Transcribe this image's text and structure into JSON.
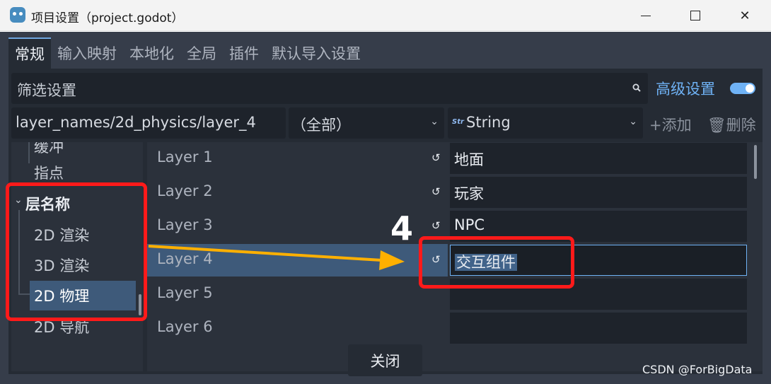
{
  "window": {
    "title": "项目设置（project.godot）"
  },
  "tabs": [
    "常规",
    "输入映射",
    "本地化",
    "全局",
    "插件",
    "默认导入设置"
  ],
  "filter": {
    "placeholder": "筛选设置",
    "advanced_label": "高级设置",
    "advanced_enabled": true
  },
  "path_bar": {
    "path": "layer_names/2d_physics/layer_4",
    "scope": "（全部）",
    "type": "String",
    "type_icon": "Str",
    "add_label": "+添加",
    "delete_label": "删除"
  },
  "tree": {
    "items": [
      "缓冲",
      "指点"
    ],
    "section": "层名称",
    "children": [
      "2D 渲染",
      "3D 渲染",
      "2D 物理",
      "2D 导航"
    ]
  },
  "grid": {
    "rows": [
      {
        "label": "Layer 1",
        "value": "地面"
      },
      {
        "label": "Layer 2",
        "value": "玩家"
      },
      {
        "label": "Layer 3",
        "value": "NPC"
      },
      {
        "label": "Layer 4",
        "value": "交互组件"
      },
      {
        "label": "Layer 5",
        "value": ""
      },
      {
        "label": "Layer 6",
        "value": ""
      }
    ]
  },
  "footer": {
    "close_label": "关闭"
  },
  "annotation": {
    "step_number": "4",
    "box_color": "#ff1a1a",
    "arrow_color": "#ffb000"
  },
  "watermark": "CSDN @ForBigData",
  "colors": {
    "accent": "#6fb2f5",
    "selection": "#3e5a7a",
    "panel": "#252b34"
  }
}
